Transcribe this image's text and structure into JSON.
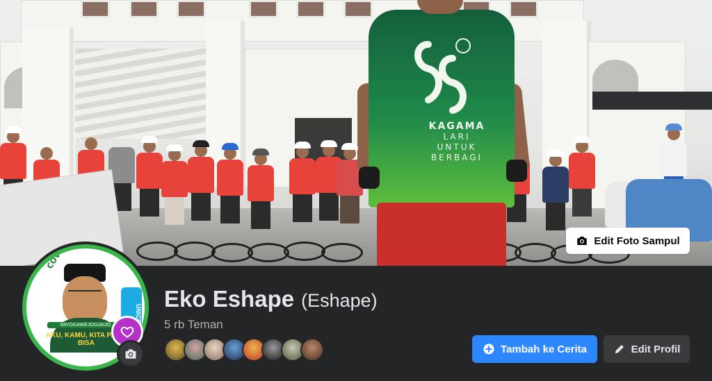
{
  "cover": {
    "edit_button_label": "Edit Foto Sampul",
    "jersey_text": {
      "brand": "KAGAMA",
      "line1": "LARI",
      "line2": "UNTUK",
      "line3": "BERBAGI"
    }
  },
  "profile": {
    "name": "Eko Eshape",
    "alternate_name": "(Eshape)",
    "friends_count": "5 rb Teman",
    "frame_text": {
      "arc_top": "SAYA SUDAH DIVAKSIN COVID-19",
      "badge": "UNICEF",
      "hashtag": "#AYOGAWEJOGJAIJO",
      "slogan": "AKU, KAMU, KITA PASTI BISA"
    }
  },
  "actions": {
    "add_story_label": "Tambah ke Cerita",
    "edit_profile_label": "Edit Profil"
  },
  "colors": {
    "primary": "#2d88ff",
    "surface": "#242526",
    "button_secondary": "#3a3b3c",
    "frame_green": "#39b54a",
    "story_badge": "#b532c9"
  },
  "icons": [
    "camera-icon",
    "plus-circle-icon",
    "pencil-icon",
    "heart-icon"
  ]
}
